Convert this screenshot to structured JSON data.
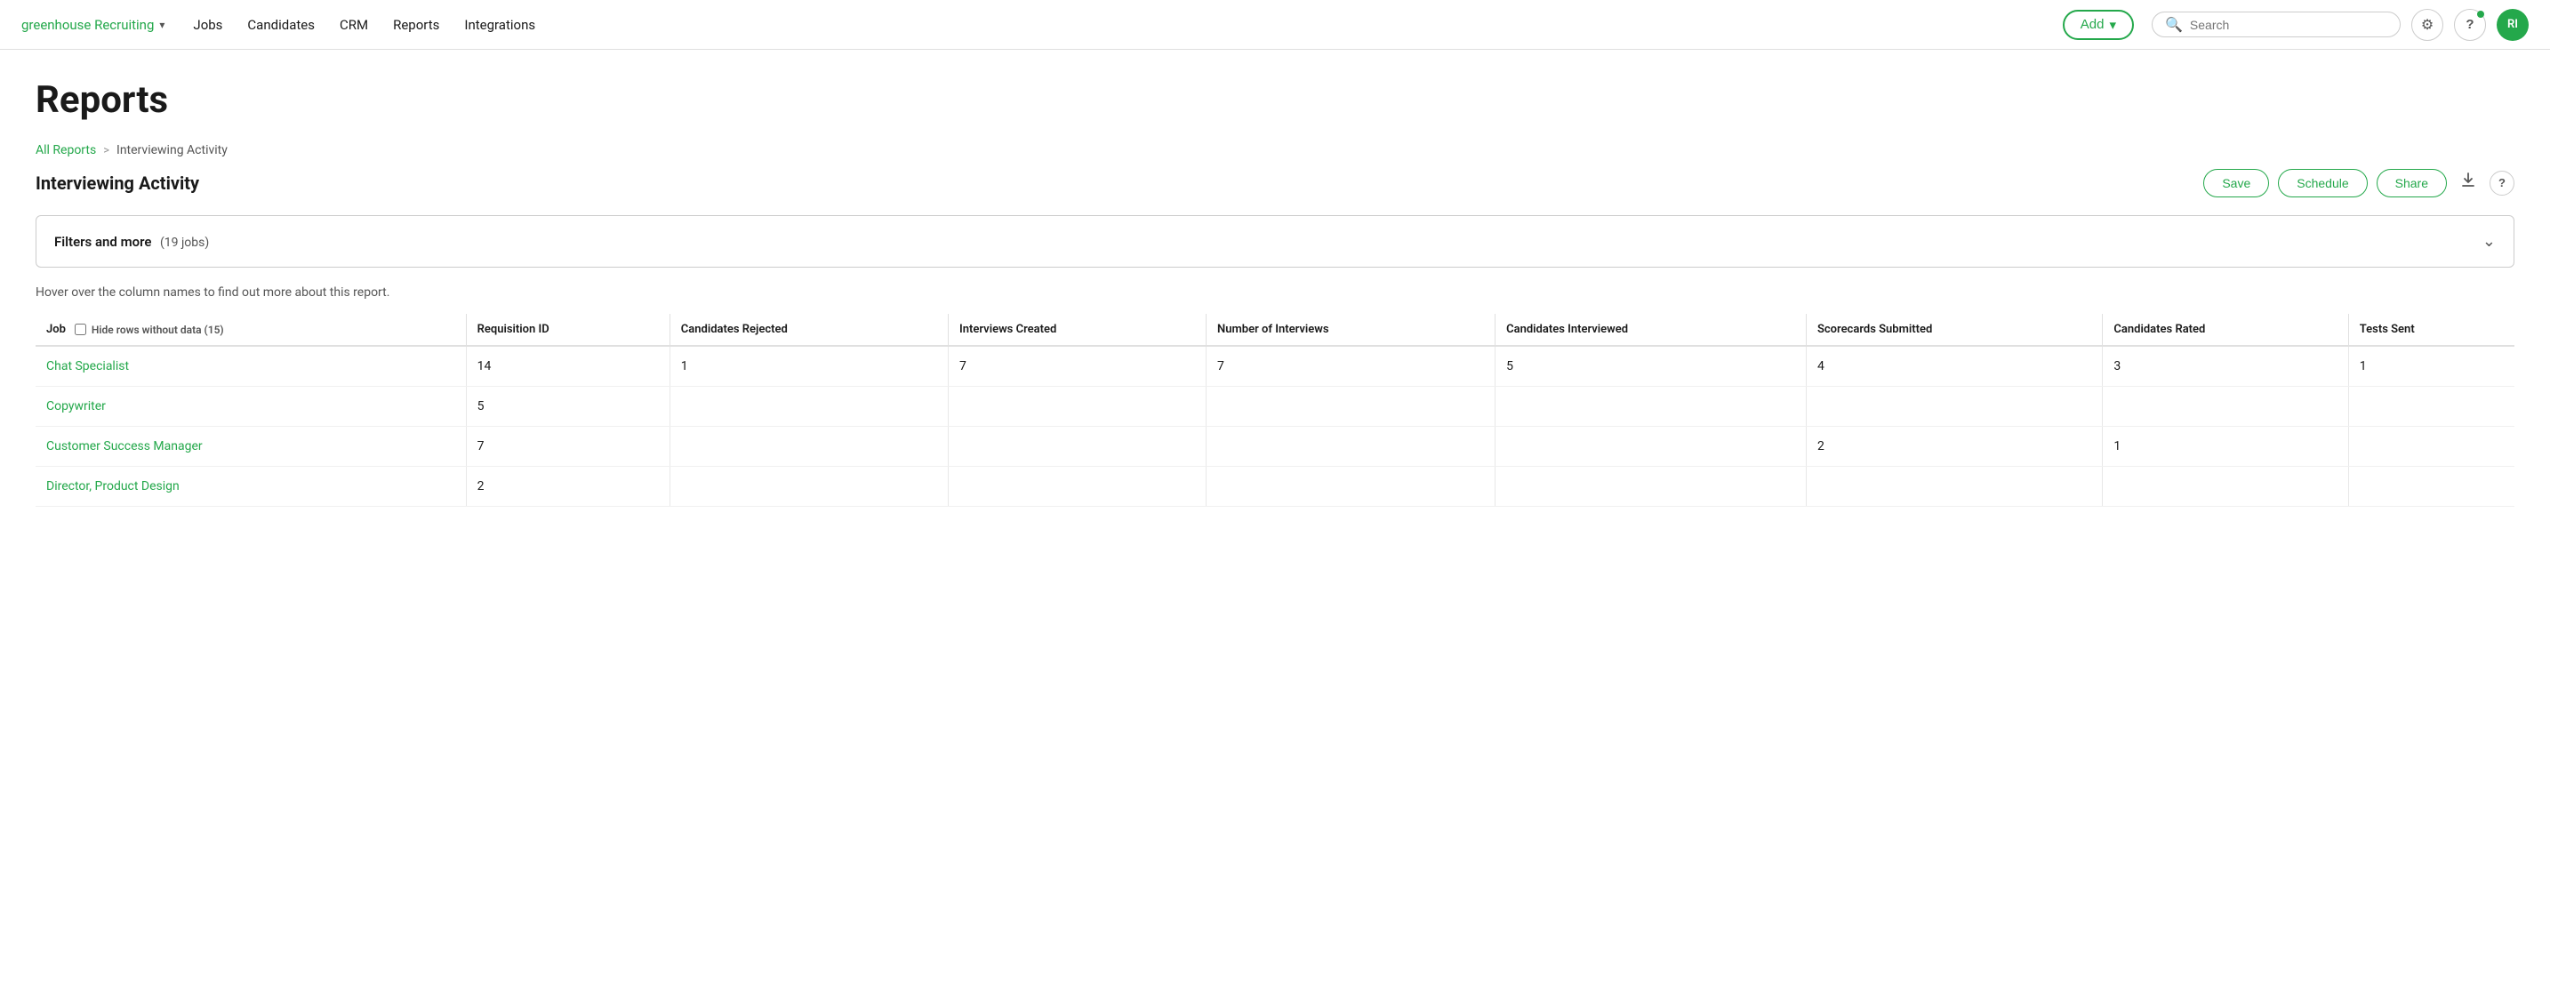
{
  "brand": {
    "name_plain": "greenhouse",
    "name_accent": "Recruiting",
    "dropdown_symbol": "▾"
  },
  "nav": {
    "links": [
      "Jobs",
      "Candidates",
      "CRM",
      "Reports",
      "Integrations"
    ],
    "add_label": "Add",
    "add_chevron": "▾"
  },
  "search": {
    "placeholder": "Search"
  },
  "icons": {
    "gear": "⚙",
    "help": "?",
    "avatar_initials": "RI",
    "download": "⬇",
    "question_circle": "?"
  },
  "page": {
    "title": "Reports",
    "breadcrumb_all": "All Reports",
    "breadcrumb_sep": ">",
    "breadcrumb_current": "Interviewing Activity",
    "report_title": "Interviewing Activity"
  },
  "actions": {
    "save": "Save",
    "schedule": "Schedule",
    "share": "Share"
  },
  "filters": {
    "label": "Filters and more",
    "count": "(19 jobs)"
  },
  "hint": "Hover over the column names to find out more about this report.",
  "table": {
    "columns": [
      "Job",
      "Requisition ID",
      "Candidates Rejected",
      "Interviews Created",
      "Number of Interviews",
      "Candidates Interviewed",
      "Scorecards Submitted",
      "Candidates Rated",
      "Tests Sent"
    ],
    "hide_rows_label": "Hide rows without data (15)",
    "rows": [
      {
        "job": "Chat Specialist",
        "requisition_id": "14",
        "candidates_rejected": "1",
        "interviews_created": "7",
        "number_of_interviews": "7",
        "candidates_interviewed": "5",
        "scorecards_submitted": "4",
        "candidates_rated": "3",
        "tests_sent": "1"
      },
      {
        "job": "Copywriter",
        "requisition_id": "5",
        "candidates_rejected": "",
        "interviews_created": "",
        "number_of_interviews": "",
        "candidates_interviewed": "",
        "scorecards_submitted": "",
        "candidates_rated": "",
        "tests_sent": ""
      },
      {
        "job": "Customer Success Manager",
        "requisition_id": "7",
        "candidates_rejected": "",
        "interviews_created": "",
        "number_of_interviews": "",
        "candidates_interviewed": "",
        "scorecards_submitted": "2",
        "candidates_rated": "1",
        "tests_sent": ""
      },
      {
        "job": "Director, Product Design",
        "requisition_id": "2",
        "candidates_rejected": "",
        "interviews_created": "",
        "number_of_interviews": "",
        "candidates_interviewed": "",
        "scorecards_submitted": "",
        "candidates_rated": "",
        "tests_sent": ""
      }
    ]
  }
}
